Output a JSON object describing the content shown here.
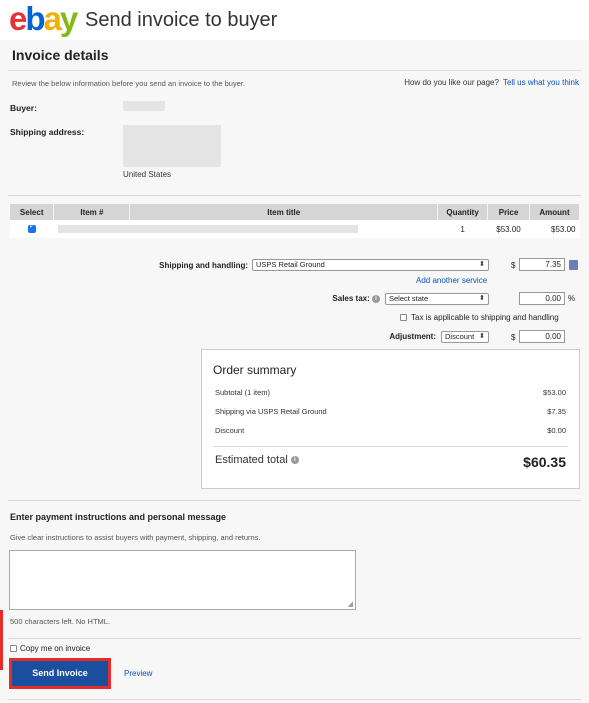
{
  "header": {
    "logo_letters": [
      "e",
      "b",
      "a",
      "y"
    ],
    "title": "Send invoice to buyer"
  },
  "invoice": {
    "section_title": "Invoice details",
    "intro": "Review the below information before you send an invoice to the buyer.",
    "feedback_question": "How do you like our page?",
    "feedback_link": "Tell us what you think",
    "buyer_label": "Buyer:",
    "shipping_label": "Shipping address:",
    "country": "United States"
  },
  "items_table": {
    "headers": [
      "Select",
      "Item #",
      "Item title",
      "Quantity",
      "Price",
      "Amount"
    ],
    "rows": [
      {
        "selected": true,
        "quantity": "1",
        "price": "$53.00",
        "amount": "$53.00"
      }
    ]
  },
  "shipping": {
    "label": "Shipping and handling:",
    "selected_service": "USPS Retail Ground",
    "currency": "$",
    "cost": "7.35",
    "add_service_link": "Add another service"
  },
  "tax": {
    "label": "Sales tax:",
    "state_placeholder": "Select state",
    "rate": "0.00",
    "percent": "%",
    "apply_to_shipping_label": "Tax is applicable to shipping and handling"
  },
  "adjustment": {
    "label": "Adjustment:",
    "type": "Discount",
    "currency": "$",
    "value": "0.00"
  },
  "summary": {
    "title": "Order summary",
    "rows": [
      {
        "label": "Subtotal (1 item)",
        "value": "$53.00"
      },
      {
        "label": "Shipping via USPS Retail Ground",
        "value": "$7.35"
      },
      {
        "label": "Discount",
        "value": "$0.00"
      }
    ],
    "total_label": "Estimated total",
    "total_value": "$60.35"
  },
  "message": {
    "title": "Enter payment instructions and personal message",
    "description": "Give clear instructions to assist buyers with payment, shipping, and returns.",
    "chars_left": "500 characters left. No HTML.",
    "copy_me_label": "Copy me on invoice"
  },
  "actions": {
    "send_label": "Send Invoice",
    "preview_label": "Preview"
  },
  "colors": {
    "accent_button": "#1a4fa0",
    "highlight_border": "#e62b2b",
    "link": "#0654ba"
  }
}
